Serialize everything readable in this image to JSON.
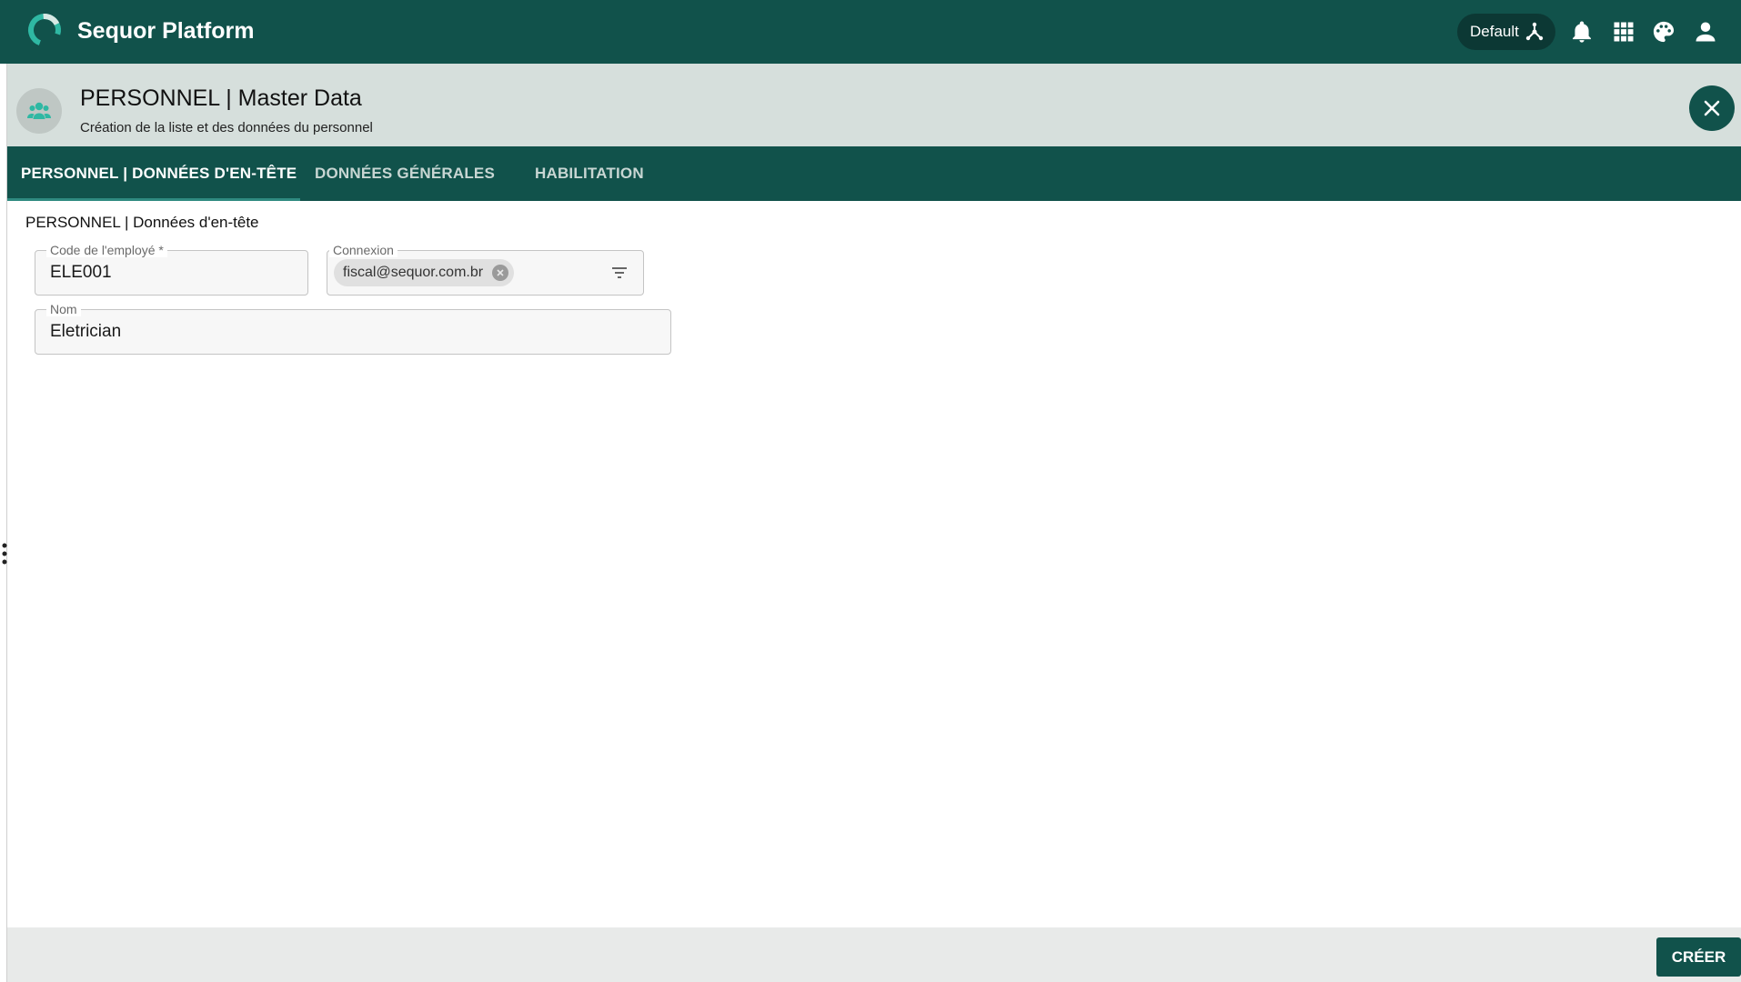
{
  "app": {
    "title": "Sequor Platform",
    "environment": "Default",
    "colors": {
      "primary": "#11524b",
      "accent": "#2fb8a3",
      "header_bg": "#d6dfdc"
    }
  },
  "topbar": {
    "icons": [
      "hierarchy-icon",
      "bell-icon",
      "apps-grid-icon",
      "palette-icon",
      "user-icon"
    ]
  },
  "page": {
    "title": "PERSONNEL | Master Data",
    "subtitle": "Création de la liste et des données du personnel",
    "avatar_icon": "people-group-icon",
    "close_icon": "close-icon"
  },
  "tabs": [
    {
      "label": "PERSONNEL | DONNÉES D'EN-TÊTE",
      "active": true
    },
    {
      "label": "DONNÉES GÉNÉRALES",
      "active": false
    },
    {
      "label": "HABILITATION",
      "active": false
    }
  ],
  "form": {
    "section_title": "PERSONNEL | Données d'en-tête",
    "employee_code": {
      "label": "Code de l'employé *",
      "value": "ELE001"
    },
    "connexion": {
      "label": "Connexion",
      "chip": "fiscal@sequor.com.br",
      "icon": "filter-icon"
    },
    "name": {
      "label": "Nom",
      "value": "Eletrician"
    }
  },
  "footer": {
    "create_label": "CRÉER"
  }
}
